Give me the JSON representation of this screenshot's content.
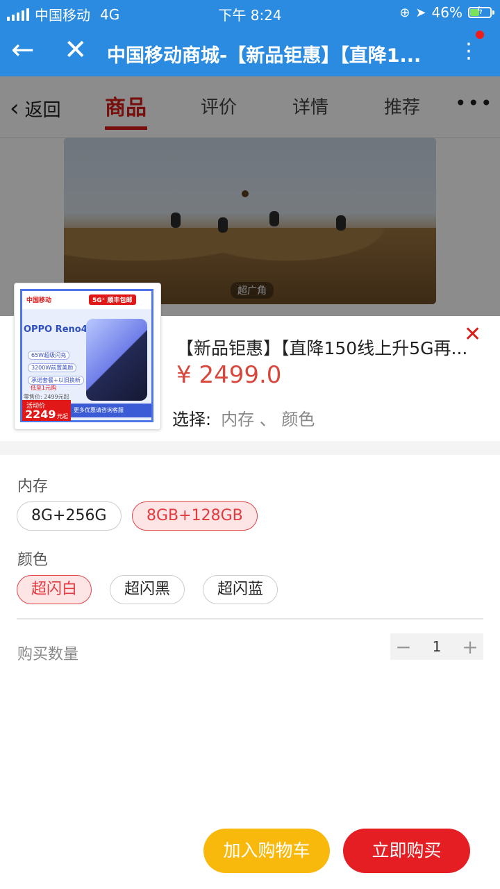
{
  "status_bar": {
    "carrier": "中国移动",
    "network": "4G",
    "time": "下午 8:24",
    "battery_pct": "46%",
    "signal_icon": "signal-bars-icon",
    "location_icon": "location-arrow-icon",
    "lock_icon": "rotation-lock-icon",
    "battery_level": 0.46
  },
  "titlebar": {
    "back_icon": "←",
    "close_icon": "✕",
    "title": "中国移动商城-【新品钜惠】【直降1...",
    "menu_icon": "⋮",
    "notify_color": "#f01c1c"
  },
  "nav": {
    "back_label": "返回",
    "tabs": [
      {
        "label": "商品"
      },
      {
        "label": "评价"
      },
      {
        "label": "详情"
      },
      {
        "label": "推荐"
      }
    ],
    "more_icon": "•••"
  },
  "hero": {
    "badge": "超广角"
  },
  "thumb": {
    "brand": "中国移动",
    "badge_5g": "5G⁺ 顺丰包邮",
    "model": "OPPO Reno4 SE",
    "features": [
      "65W超级闪充",
      "3200W前置美颜",
      "承诺套餐+以旧换新",
      "低至1元购"
    ],
    "retail_label": "零售价: 2499元起",
    "activity_label": "活动价",
    "activity_price": "2249",
    "activity_unit": "元起",
    "consult": "更多优惠请咨询客服"
  },
  "product": {
    "title": "【新品钜惠】【直降150线上升5G再...",
    "price": "¥ 2499.0",
    "select_label": "选择:",
    "select_value": "内存 、 颜色",
    "close_icon": "✕"
  },
  "memory": {
    "label": "内存",
    "options": [
      "8G+256G",
      "8GB+128GB"
    ],
    "selected": "8GB+128GB"
  },
  "color": {
    "label": "颜色",
    "options": [
      "超闪白",
      "超闪黑",
      "超闪蓝"
    ],
    "selected": "超闪白"
  },
  "quantity": {
    "label": "购买数量",
    "minus": "−",
    "value": "1",
    "plus": "+"
  },
  "actions": {
    "add_to_cart": "加入购物车",
    "buy_now": "立即购买",
    "cart_color": "#f9b80c",
    "buy_color": "#e51e23"
  }
}
